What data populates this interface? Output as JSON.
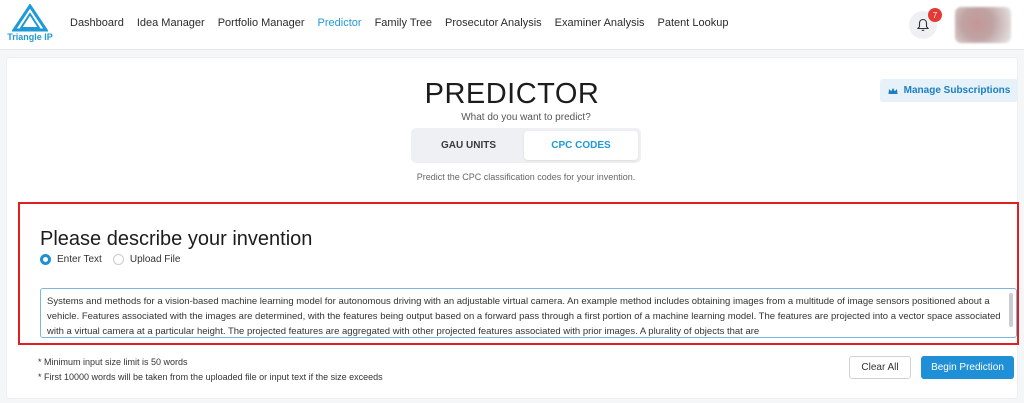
{
  "brand": {
    "name_part1": "Triangle",
    "name_part2": "IP",
    "icon": "triangle-logo-icon",
    "color": "#1f9ad6"
  },
  "nav": {
    "items": [
      "Dashboard",
      "Idea Manager",
      "Portfolio Manager",
      "Predictor",
      "Family Tree",
      "Prosecutor Analysis",
      "Examiner Analysis",
      "Patent Lookup"
    ],
    "active": "Predictor"
  },
  "notifications": {
    "icon": "bell-icon",
    "count": "7"
  },
  "header": {
    "title": "PREDICTOR",
    "subtitle": "What do you want to predict?",
    "manage_label": "Manage Subscriptions",
    "manage_icon": "crown-icon"
  },
  "toggle": {
    "options": [
      "GAU UNITS",
      "CPC CODES"
    ],
    "selected": "CPC CODES"
  },
  "hint": "Predict the CPC classification codes for your invention.",
  "invention": {
    "title": "Please describe your invention",
    "input_modes": [
      "Enter Text",
      "Upload File"
    ],
    "selected_mode": "Enter Text",
    "text_value": "Systems and methods for a vision-based machine learning model for autonomous driving with an adjustable virtual camera. An example method includes obtaining images from a multitude of image sensors positioned about a vehicle. Features associated with the images are determined, with the features being output based on a forward pass through a first portion of a machine learning model. The features are projected into a vector space associated with a virtual camera at a particular height. The projected features are aggregated with other projected features associated with prior images. A plurality of objects that are"
  },
  "notes": [
    "* Minimum input size limit is 50 words",
    "* First 10000 words will be taken from the uploaded file or input text if the size exceeds"
  ],
  "actions": {
    "clear_label": "Clear All",
    "begin_label": "Begin Prediction"
  },
  "colors": {
    "accent": "#1f8fd6",
    "highlight_border": "#e02020",
    "badge": "#e53935"
  }
}
